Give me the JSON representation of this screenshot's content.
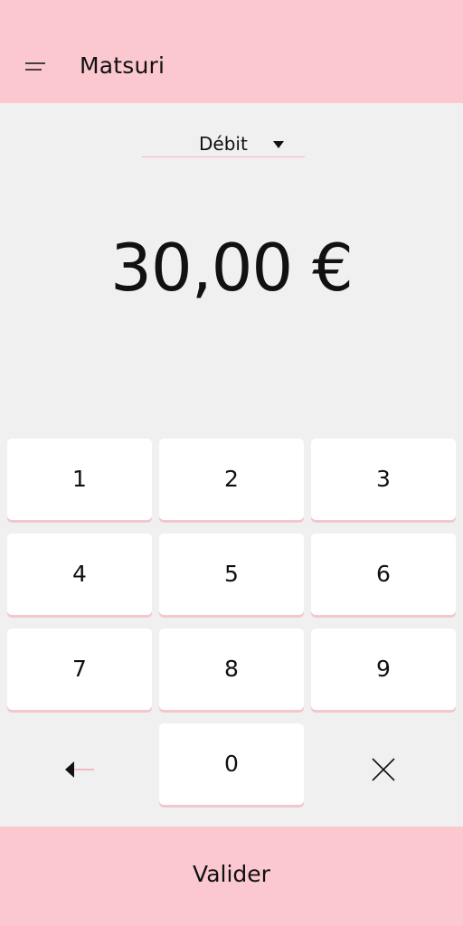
{
  "app": {
    "title": "Matsuri",
    "menu_icon": "hamburger-menu-icon",
    "brand_color": "#fbc8cf"
  },
  "transaction": {
    "type": "Débit",
    "amount": "30,00 €"
  },
  "keypad": {
    "keys": [
      "1",
      "2",
      "3",
      "4",
      "5",
      "6",
      "7",
      "8",
      "9",
      "0"
    ],
    "backspace_icon": "backspace-arrow-icon",
    "clear_icon": "close-icon"
  },
  "footer": {
    "validate_label": "Valider"
  }
}
